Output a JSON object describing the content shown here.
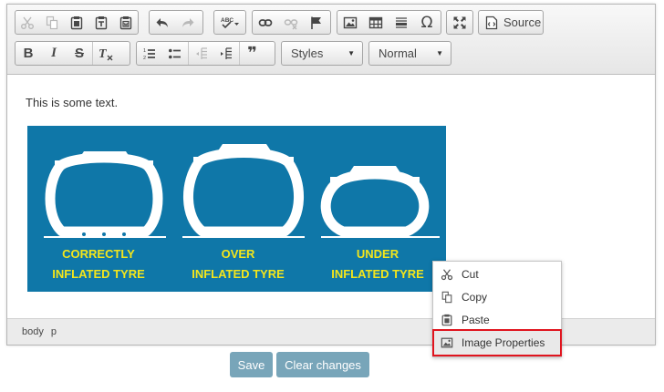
{
  "toolbar": {
    "row1": [
      {
        "name": "cut-button",
        "icon": "scissors-icon",
        "disabled": true
      },
      {
        "name": "copy-button",
        "icon": "copy-icon",
        "disabled": true
      },
      {
        "name": "paste-button",
        "icon": "clipboard-icon",
        "disabled": false
      },
      {
        "name": "paste-text-button",
        "icon": "clipboard-text-icon",
        "disabled": false
      },
      {
        "name": "paste-from-word-button",
        "icon": "clipboard-word-icon",
        "disabled": false
      },
      {
        "name": "undo-button",
        "icon": "undo-icon",
        "disabled": false
      },
      {
        "name": "redo-button",
        "icon": "redo-icon",
        "disabled": true
      },
      {
        "name": "spellcheck-button",
        "icon": "spellcheck-icon",
        "disabled": false
      },
      {
        "name": "link-button",
        "icon": "link-icon",
        "disabled": false
      },
      {
        "name": "unlink-button",
        "icon": "unlink-icon",
        "disabled": true
      },
      {
        "name": "anchor-button",
        "icon": "flag-icon",
        "disabled": false
      },
      {
        "name": "image-button",
        "icon": "image-icon",
        "disabled": false
      },
      {
        "name": "table-button",
        "icon": "table-icon",
        "disabled": false
      },
      {
        "name": "horizontal-line-button",
        "icon": "horizontal-line-icon",
        "disabled": false
      },
      {
        "name": "special-char-button",
        "icon": "omega-icon",
        "disabled": false
      },
      {
        "name": "maximize-button",
        "icon": "maximize-icon",
        "disabled": false
      }
    ],
    "source_label": "Source",
    "styles_label": "Styles",
    "format_label": "Normal",
    "omega_glyph": "Ω",
    "quote_glyph": "❞"
  },
  "content": {
    "paragraph": "This is some text.",
    "image": {
      "captions": [
        {
          "line1": "CORRECTLY",
          "line2": "INFLATED TYRE"
        },
        {
          "line1": "OVER",
          "line2": "INFLATED TYRE"
        },
        {
          "line1": "UNDER",
          "line2": "INFLATED TYRE"
        }
      ],
      "background": "#0f77a8",
      "caption_color": "#f4e61b"
    }
  },
  "statusbar": {
    "path": [
      "body",
      "p"
    ]
  },
  "context_menu": {
    "items": [
      {
        "label": "Cut",
        "icon": "scissors-icon"
      },
      {
        "label": "Copy",
        "icon": "copy-icon"
      },
      {
        "label": "Paste",
        "icon": "clipboard-icon"
      },
      {
        "label": "Image Properties",
        "icon": "image-icon",
        "highlighted": true
      }
    ],
    "highlight_color": "#e0141e"
  },
  "buttons": {
    "save": "Save",
    "clear": "Clear changes"
  }
}
